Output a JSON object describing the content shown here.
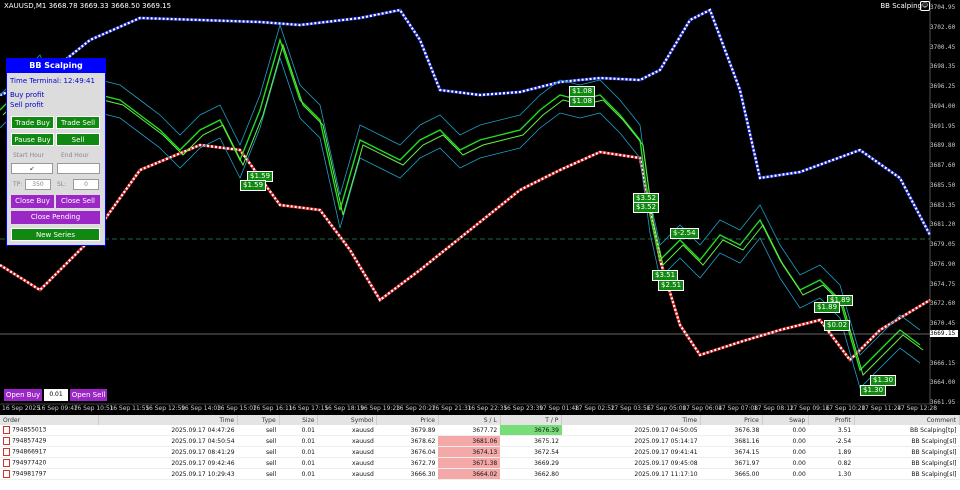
{
  "chart": {
    "symbol_line": "XAUUSD,M1  3668.78 3669.33 3668.50 3669.15",
    "ea_label": "BB Scalping",
    "face_icon": "smiley-icon",
    "price_ticks": [
      "3704.95",
      "3700.95",
      "3696.95",
      "3692.95",
      "3688.85",
      "3684.85",
      "3680.85",
      "3676.85",
      "3672.90",
      "3668.90",
      "3664.90",
      "3660.90",
      "3656.90"
    ],
    "prices": [
      {
        "label": "3704.95"
      },
      {
        "label": "3702.60"
      },
      {
        "label": "3700.45"
      },
      {
        "label": "3698.35"
      },
      {
        "label": "3696.25"
      },
      {
        "label": "3694.00"
      },
      {
        "label": "3691.95"
      },
      {
        "label": "3689.80"
      },
      {
        "label": "3687.60"
      },
      {
        "label": "3685.50"
      },
      {
        "label": "3683.35"
      },
      {
        "label": "3681.20"
      },
      {
        "label": "3679.05"
      },
      {
        "label": "3676.90"
      },
      {
        "label": "3674.75"
      },
      {
        "label": "3672.60"
      },
      {
        "label": "3670.45"
      },
      {
        "label": "3669.15",
        "highlight": true
      },
      {
        "label": "3666.15"
      },
      {
        "label": "3664.00"
      },
      {
        "label": "3661.95"
      }
    ],
    "times": [
      "16 Sep 2025",
      "16 Sep 09:47",
      "16 Sep 10:51",
      "16 Sep 11:55",
      "16 Sep 12:59",
      "16 Sep 14:03",
      "16 Sep 15:07",
      "16 Sep 16:11",
      "16 Sep 17:15",
      "16 Sep 18:19",
      "16 Sep 19:23",
      "16 Sep 20:27",
      "16 Sep 21:31",
      "16 Sep 22:35",
      "16 Sep 23:39",
      "17 Sep 01:48",
      "17 Sep 02:52",
      "17 Sep 03:56",
      "17 Sep 05:00",
      "17 Sep 06:04",
      "17 Sep 07:08",
      "17 Sep 08:12",
      "17 Sep 09:16",
      "17 Sep 10:20",
      "17 Sep 11:24",
      "17 Sep 12:28"
    ],
    "tags": [
      {
        "text": "$3.50"
      },
      {
        "text": "$3.50"
      },
      {
        "text": "$-2.50"
      },
      {
        "text": "$1.59"
      },
      {
        "text": "$1.59"
      },
      {
        "text": "$1.08"
      },
      {
        "text": "$1.08"
      },
      {
        "text": "$3.52"
      },
      {
        "text": "$3.52"
      },
      {
        "text": "$-2.54"
      },
      {
        "text": "$3.51"
      },
      {
        "text": "$2.51"
      },
      {
        "text": "$1.89"
      },
      {
        "text": "$1.89"
      },
      {
        "text": "$0.02"
      },
      {
        "text": "$1.30"
      },
      {
        "text": "$1.30"
      }
    ]
  },
  "panel": {
    "title": "BB Scalping",
    "time_terminal": "Time Terminal: 12:49:41",
    "buy_profit": "Buy profit",
    "sell_profit": "Sell profit",
    "trade_buy": "Trade Buy",
    "trade_sell": "Trade Sell",
    "pause_buy": "Pause Buy",
    "pause_sell": "Sell",
    "start_hour": "Start Hour",
    "end_hour": "End Hour",
    "tp_label": "TP:",
    "tp_value": "350",
    "sl_label": "SL:",
    "sl_value": "0",
    "close_buy": "Close Buy",
    "close_sell": "Close Sell",
    "close_pending": "Close Pending",
    "new_series": "New Series"
  },
  "quick": {
    "open_buy": "Open Buy",
    "lot": "0.01",
    "open_sell": "Open Sell"
  },
  "table": {
    "headers": [
      "Order",
      "Time",
      "Type",
      "Size",
      "Symbol",
      "Price",
      "S / L",
      "T / P",
      "Time",
      "Price",
      "Swap",
      "Profit",
      "Comment"
    ],
    "rows": [
      {
        "order": "794855013",
        "time": "2025.09.17 04:47:26",
        "type": "sell",
        "size": "0.01",
        "symbol": "xauusd",
        "price": "3679.89",
        "sl": "3677.72",
        "tp": "3676.39",
        "close_time": "2025.09.17 04:50:05",
        "close_price": "3676.38",
        "swap": "0.00",
        "profit": "3.51",
        "comment": "BB Scalping[tp]",
        "mark": "tp"
      },
      {
        "order": "794857429",
        "time": "2025.09.17 04:50:54",
        "type": "sell",
        "size": "0.01",
        "symbol": "xauusd",
        "price": "3678.62",
        "sl": "3681.06",
        "tp": "3675.12",
        "close_time": "2025.09.17 05:14:17",
        "close_price": "3681.16",
        "swap": "0.00",
        "profit": "-2.54",
        "comment": "BB Scalping[sl]",
        "mark": "sl"
      },
      {
        "order": "794866917",
        "time": "2025.09.17 08:41:29",
        "type": "sell",
        "size": "0.01",
        "symbol": "xauusd",
        "price": "3676.04",
        "sl": "3674.13",
        "tp": "3672.54",
        "close_time": "2025.09.17 09:41:41",
        "close_price": "3674.15",
        "swap": "0.00",
        "profit": "1.89",
        "comment": "BB Scalping[sl]",
        "mark": "sl"
      },
      {
        "order": "794977420",
        "time": "2025.09.17 09:42:46",
        "type": "sell",
        "size": "0.01",
        "symbol": "xauusd",
        "price": "3672.79",
        "sl": "3671.38",
        "tp": "3669.29",
        "close_time": "2025.09.17 09:45:08",
        "close_price": "3671.97",
        "swap": "0.00",
        "profit": "0.82",
        "comment": "BB Scalping[sl]",
        "mark": "sl"
      },
      {
        "order": "794981797",
        "time": "2025.09.17 10:29:43",
        "type": "sell",
        "size": "0.01",
        "symbol": "xauusd",
        "price": "3666.30",
        "sl": "3664.02",
        "tp": "3662.80",
        "close_time": "2025.09.17 11:17:10",
        "close_price": "3665.00",
        "swap": "0.00",
        "profit": "1.30",
        "comment": "BB Scalping[sl]",
        "mark": "sl"
      }
    ]
  }
}
